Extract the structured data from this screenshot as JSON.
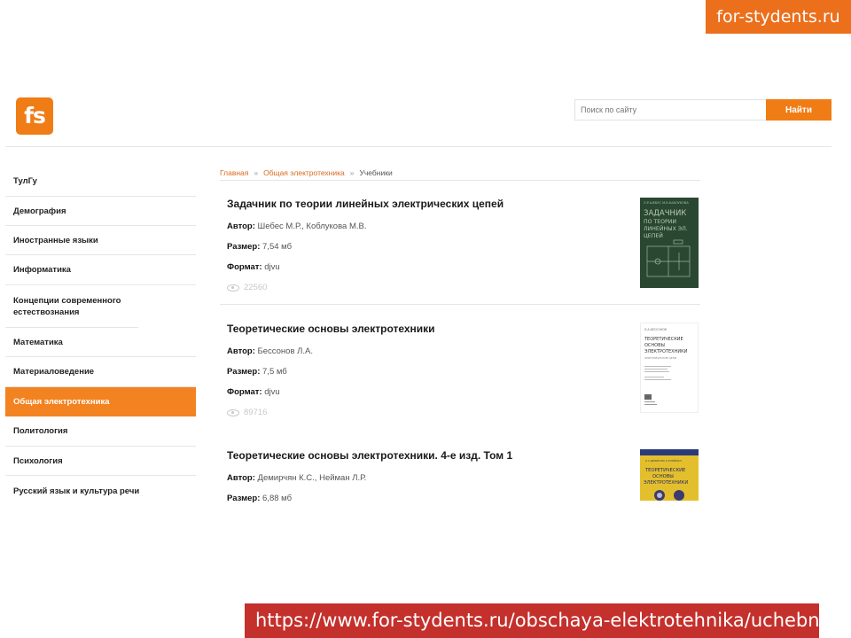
{
  "brand_badge": "for-stydents.ru",
  "header": {
    "logo_text": "fs",
    "search_placeholder": "Поиск по сайту",
    "search_button": "Найти"
  },
  "sidebar": {
    "items": [
      {
        "label": "ТулГу"
      },
      {
        "label": "Демография"
      },
      {
        "label": "Иностранные языки"
      },
      {
        "label": "Информатика"
      },
      {
        "label": "Концепции современного естествознания"
      },
      {
        "label": "Математика"
      },
      {
        "label": "Материаловедение"
      },
      {
        "label": "Общая электротехника",
        "active": true
      },
      {
        "label": "Политология"
      },
      {
        "label": "Психология"
      },
      {
        "label": "Русский язык и культура речи"
      }
    ]
  },
  "breadcrumb": {
    "home": "Главная",
    "section": "Общая электротехника",
    "current": "Учебники",
    "separator": "»"
  },
  "labels": {
    "author": "Автор:",
    "size": "Размер:",
    "format": "Формат:"
  },
  "books": [
    {
      "title": "Задачник по теории линейных электрических цепей",
      "author": "Шебес М.Р., Коблукова М.В.",
      "size": "7,54 мб",
      "format": "djvu",
      "views": "22560",
      "cover_title": "ЗАДАЧНИК ПО ТЕОРИИ ЛИНЕЙНЫХ ЦЕПЕЙ",
      "cover_color": "#2c4a34"
    },
    {
      "title": "Теоретические основы электротехники",
      "author": "Бессонов Л.А.",
      "size": "7,5 мб",
      "format": "djvu",
      "views": "89716",
      "cover_title": "ТЕОРЕТИЧЕСКИЕ ОСНОВЫ ЭЛЕКТРОТЕХНИКИ",
      "cover_color": "#ffffff"
    },
    {
      "title": "Теоретические основы электротехники. 4-е изд. Том 1",
      "author": "Демирчян К.С., Нейман Л.Р.",
      "size": "6,88 мб",
      "format": "",
      "views": "",
      "cover_title": "ТЕОРЕТИЧЕСКИЕ ОСНОВЫ ЭЛЕКТРОТЕХНИКИ",
      "cover_color": "#e0ba2a"
    }
  ],
  "url_caption": "https://www.for-stydents.ru/obschaya-elektrotehnika/uchebniki/"
}
